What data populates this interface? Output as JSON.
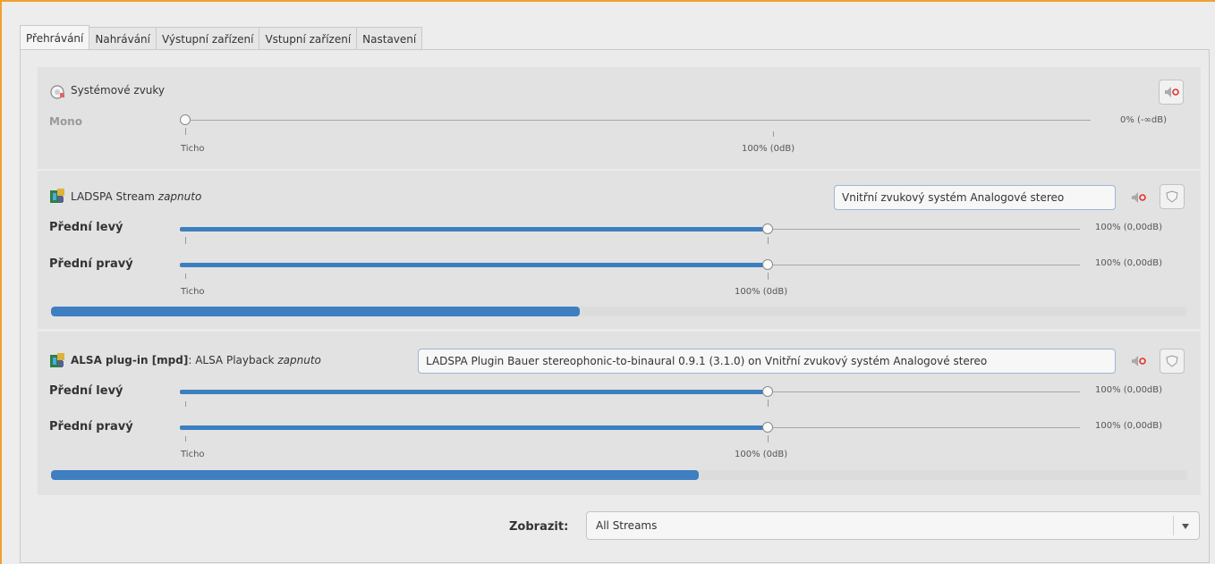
{
  "tabs": [
    "Přehrávání",
    "Nahrávání",
    "Výstupní zařízení",
    "Vstupní zařízení",
    "Nastavení"
  ],
  "system_sounds": {
    "title": "Systémové zvuky",
    "channel": "Mono",
    "value_text": "0% (-∞dB)",
    "level": 0,
    "scale_left": "Ticho",
    "scale_mid": "100% (0dB)",
    "mute_icon": "speaker-mute-icon"
  },
  "ladspa_stream": {
    "name": "LADSPA Stream",
    "state": "zapnuto",
    "device": "Vnitřní zvukový systém Analogové stereo",
    "channels": [
      {
        "label": "Přední levý",
        "value_text": "100% (0,00dB)",
        "level": 1.0
      },
      {
        "label": "Přední pravý",
        "value_text": "100% (0,00dB)",
        "level": 1.0
      }
    ],
    "scale_left": "Ticho",
    "scale_mid": "100% (0dB)",
    "meter_level": 0.465,
    "icon": "plugin-icon",
    "mute_icon": "speaker-mute-icon",
    "lock_icon": "shield-lock-icon"
  },
  "alsa_stream": {
    "name": "ALSA plug-in [mpd]",
    "subtitle": ": ALSA Playback",
    "state": "zapnuto",
    "device": "LADSPA Plugin Bauer stereophonic-to-binaural 0.9.1 (3.1.0) on Vnitřní zvukový systém Analogové stereo",
    "channels": [
      {
        "label": "Přední levý",
        "value_text": "100% (0,00dB)",
        "level": 1.0
      },
      {
        "label": "Přední pravý",
        "value_text": "100% (0,00dB)",
        "level": 1.0
      }
    ],
    "scale_left": "Ticho",
    "scale_mid": "100% (0dB)",
    "meter_level": 0.57,
    "icon": "plugin-icon",
    "mute_icon": "speaker-mute-icon",
    "lock_icon": "shield-lock-icon"
  },
  "footer": {
    "show_label": "Zobrazit:",
    "show_value": "All Streams",
    "dropdown_icon": "chevron-down-icon"
  }
}
